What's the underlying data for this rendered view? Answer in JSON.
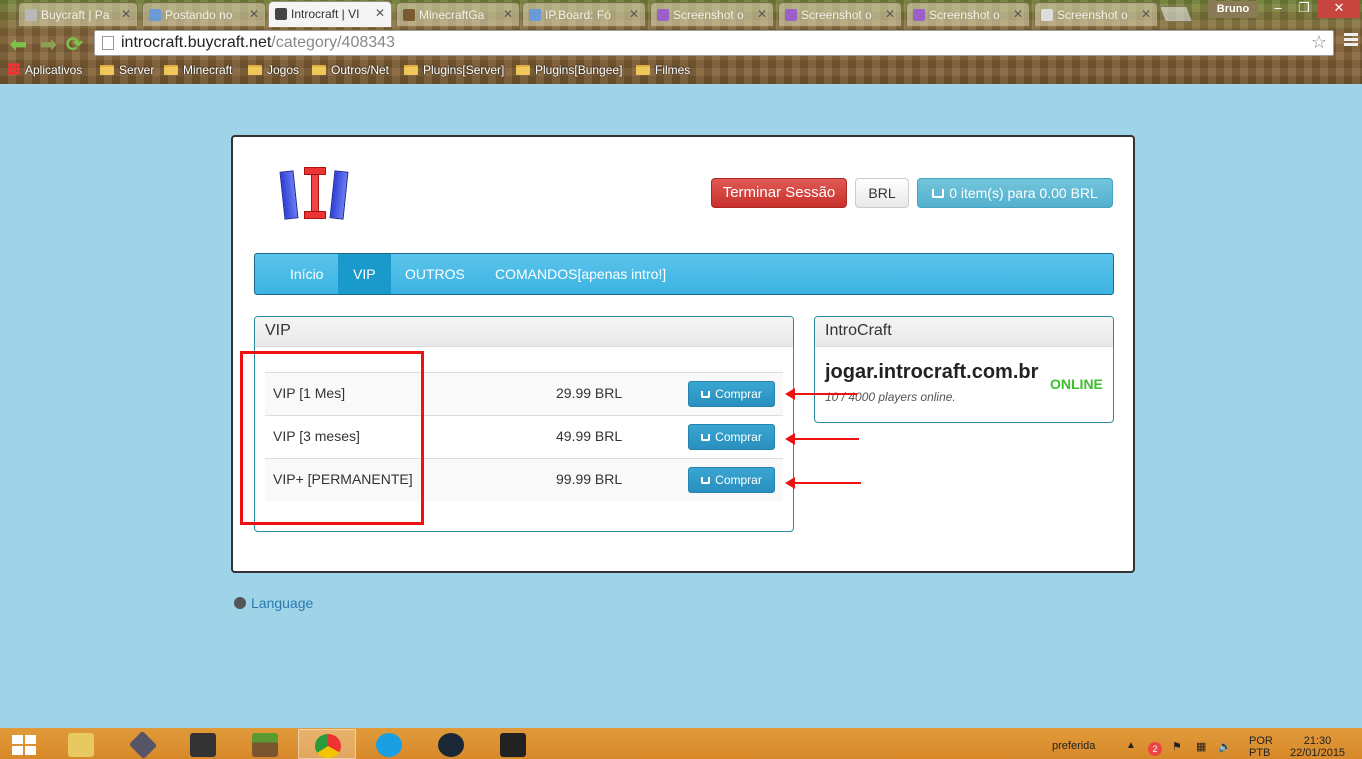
{
  "browser": {
    "tabs": [
      {
        "title": "Buycraft | Pa",
        "active": false,
        "icon_color": "#b8b8b8"
      },
      {
        "title": "Postando no",
        "active": false,
        "icon_color": "#6a9ad8"
      },
      {
        "title": "Introcraft | VI",
        "active": true,
        "icon_color": "#444444"
      },
      {
        "title": "MinecraftGa",
        "active": false,
        "icon_color": "#7a5a30"
      },
      {
        "title": "IP.Board: Fó",
        "active": false,
        "icon_color": "#6a9ad8"
      },
      {
        "title": "Screenshot o",
        "active": false,
        "icon_color": "#9a60c8"
      },
      {
        "title": "Screenshot o",
        "active": false,
        "icon_color": "#9a60c8"
      },
      {
        "title": "Screenshot o",
        "active": false,
        "icon_color": "#9a60c8"
      },
      {
        "title": "Screenshot o",
        "active": false,
        "icon_color": "#cccccc"
      }
    ],
    "profile_name": "Bruno",
    "window_controls": {
      "minimize": "–",
      "restore": "❐",
      "close": "✕"
    },
    "url_host": "introcraft.buycraft.net",
    "url_path": "/category/408343",
    "bookmarks": [
      "Aplicativos",
      "Server",
      "Minecraft",
      "Jogos",
      "Outros/Net",
      "Plugins[Server]",
      "Plugins[Bungee]",
      "Filmes"
    ]
  },
  "header": {
    "logout_label": "Terminar Sessão",
    "currency_label": "BRL",
    "cart_label": "0 item(s) para 0.00 BRL"
  },
  "nav": {
    "items": [
      {
        "label": "Início",
        "active": false
      },
      {
        "label": "VIP",
        "active": true
      },
      {
        "label": "OUTROS",
        "active": false
      },
      {
        "label": "COMANDOS[apenas intro!]",
        "active": false
      }
    ]
  },
  "category": {
    "title": "VIP",
    "packages": [
      {
        "name": "VIP [1 Mes]",
        "price": "29.99 BRL",
        "buy_label": "Comprar"
      },
      {
        "name": "VIP [3 meses]",
        "price": "49.99 BRL",
        "buy_label": "Comprar"
      },
      {
        "name": "VIP+ [PERMANENTE]",
        "price": "99.99 BRL",
        "buy_label": "Comprar"
      }
    ]
  },
  "sidebar": {
    "title": "IntroCraft",
    "server_address": "jogar.introcraft.com.br",
    "status": "ONLINE",
    "players": "10 / 4000 players online."
  },
  "footer": {
    "language_label": "Language"
  },
  "taskbar": {
    "keyboard_label": "preferida",
    "lang_line1": "POR",
    "lang_line2": "PTB",
    "time": "21:30",
    "date": "22/01/2015",
    "notification_count": "2"
  },
  "colors": {
    "page_bg": "#9ed3e8",
    "nav_bar": "#3bb3e2",
    "danger": "#c9302c",
    "online": "#3bbf2a",
    "annotation": "#ee1111"
  }
}
